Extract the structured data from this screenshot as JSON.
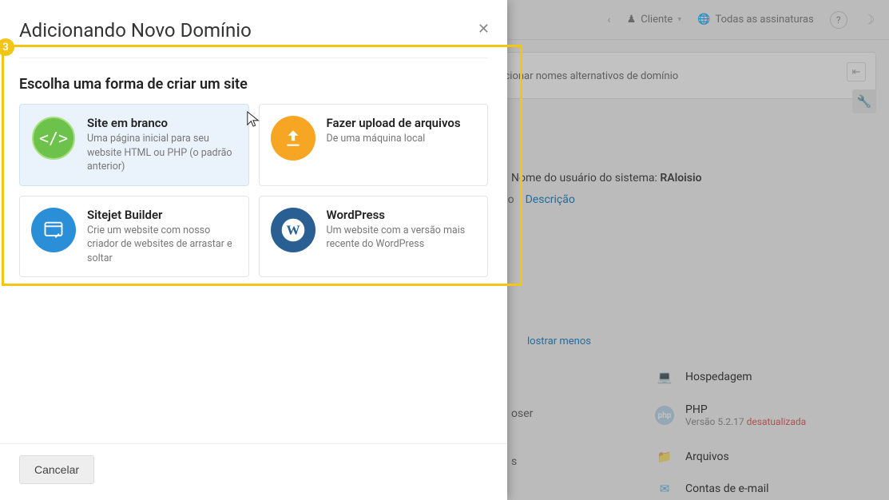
{
  "topbar": {
    "client_label": "Cliente",
    "subscriptions_label": "Todas as assinaturas"
  },
  "background": {
    "alt_names_btn": "dicionar nomes alternativos de domínio",
    "system_user_label": "Nome do usuário do sistema:",
    "system_user_value": "RAloisio",
    "tab_overview_fragment": "ão",
    "tab_description": "Descrição",
    "show_less": "lostrar menos",
    "mid_word1": "oser",
    "mid_word2": "s",
    "features": {
      "hosting_label": "Hospedagem",
      "php_label": "PHP",
      "php_version_prefix": "Versão 5.2.17",
      "php_outdated": "desatualizada",
      "files_label": "Arquivos",
      "mail_label": "Contas de e-mail"
    }
  },
  "modal": {
    "title": "Adicionando Novo Domínio",
    "section_heading": "Escolha uma forma de criar um site",
    "cards": {
      "blank": {
        "title": "Site em branco",
        "desc": "Uma página inicial para seu website HTML ou PHP (o padrão anterior)"
      },
      "upload": {
        "title": "Fazer upload de arquivos",
        "desc": "De uma máquina local"
      },
      "sitejet": {
        "title": "Sitejet Builder",
        "desc": "Crie um website com nosso criador de websites de arrastar e soltar"
      },
      "wordpress": {
        "title": "WordPress",
        "desc": "Um website com a versão mais recente do WordPress"
      }
    },
    "cancel_label": "Cancelar"
  },
  "highlight": {
    "step_number": "3"
  }
}
